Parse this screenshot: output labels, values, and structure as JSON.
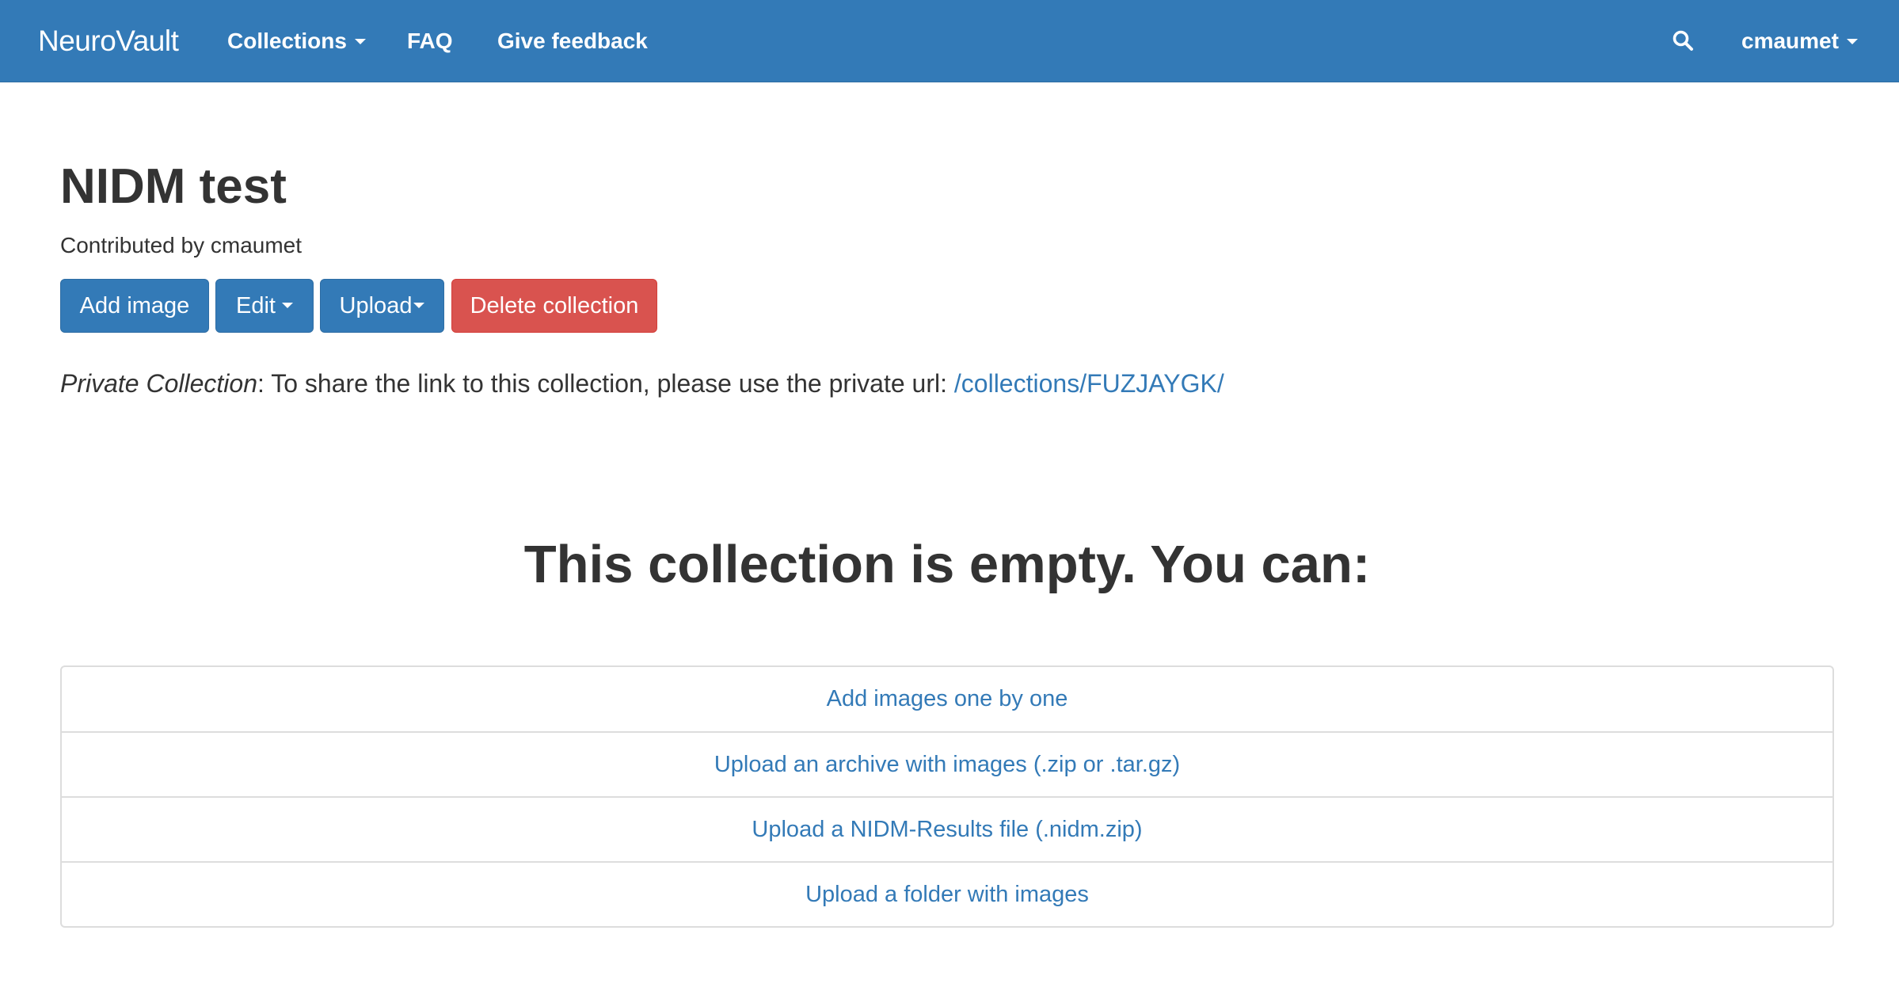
{
  "navbar": {
    "brand": "NeuroVault",
    "links": [
      {
        "label": "Collections",
        "dropdown": true
      },
      {
        "label": "FAQ",
        "dropdown": false
      },
      {
        "label": "Give feedback",
        "dropdown": false
      }
    ],
    "search_icon": "search-icon",
    "user": {
      "label": "cmaumet",
      "dropdown": true
    }
  },
  "collection": {
    "title": "NIDM test",
    "contributed_by": "Contributed by cmaumet",
    "actions": {
      "add_image": "Add image",
      "edit": "Edit",
      "upload": "Upload",
      "delete": "Delete collection"
    },
    "private_note": {
      "label": "Private Collection",
      "text": ": To share the link to this collection, please use the private url: ",
      "url": "/collections/FUZJAYGK/"
    }
  },
  "empty_state": {
    "heading": "This collection is empty. You can:",
    "options": [
      "Add images one by one",
      "Upload an archive with images (.zip or .tar.gz)",
      "Upload a NIDM-Results file (.nidm.zip)",
      "Upload a folder with images"
    ]
  },
  "colors": {
    "primary": "#337ab7",
    "danger": "#d9534f",
    "text": "#333333"
  }
}
